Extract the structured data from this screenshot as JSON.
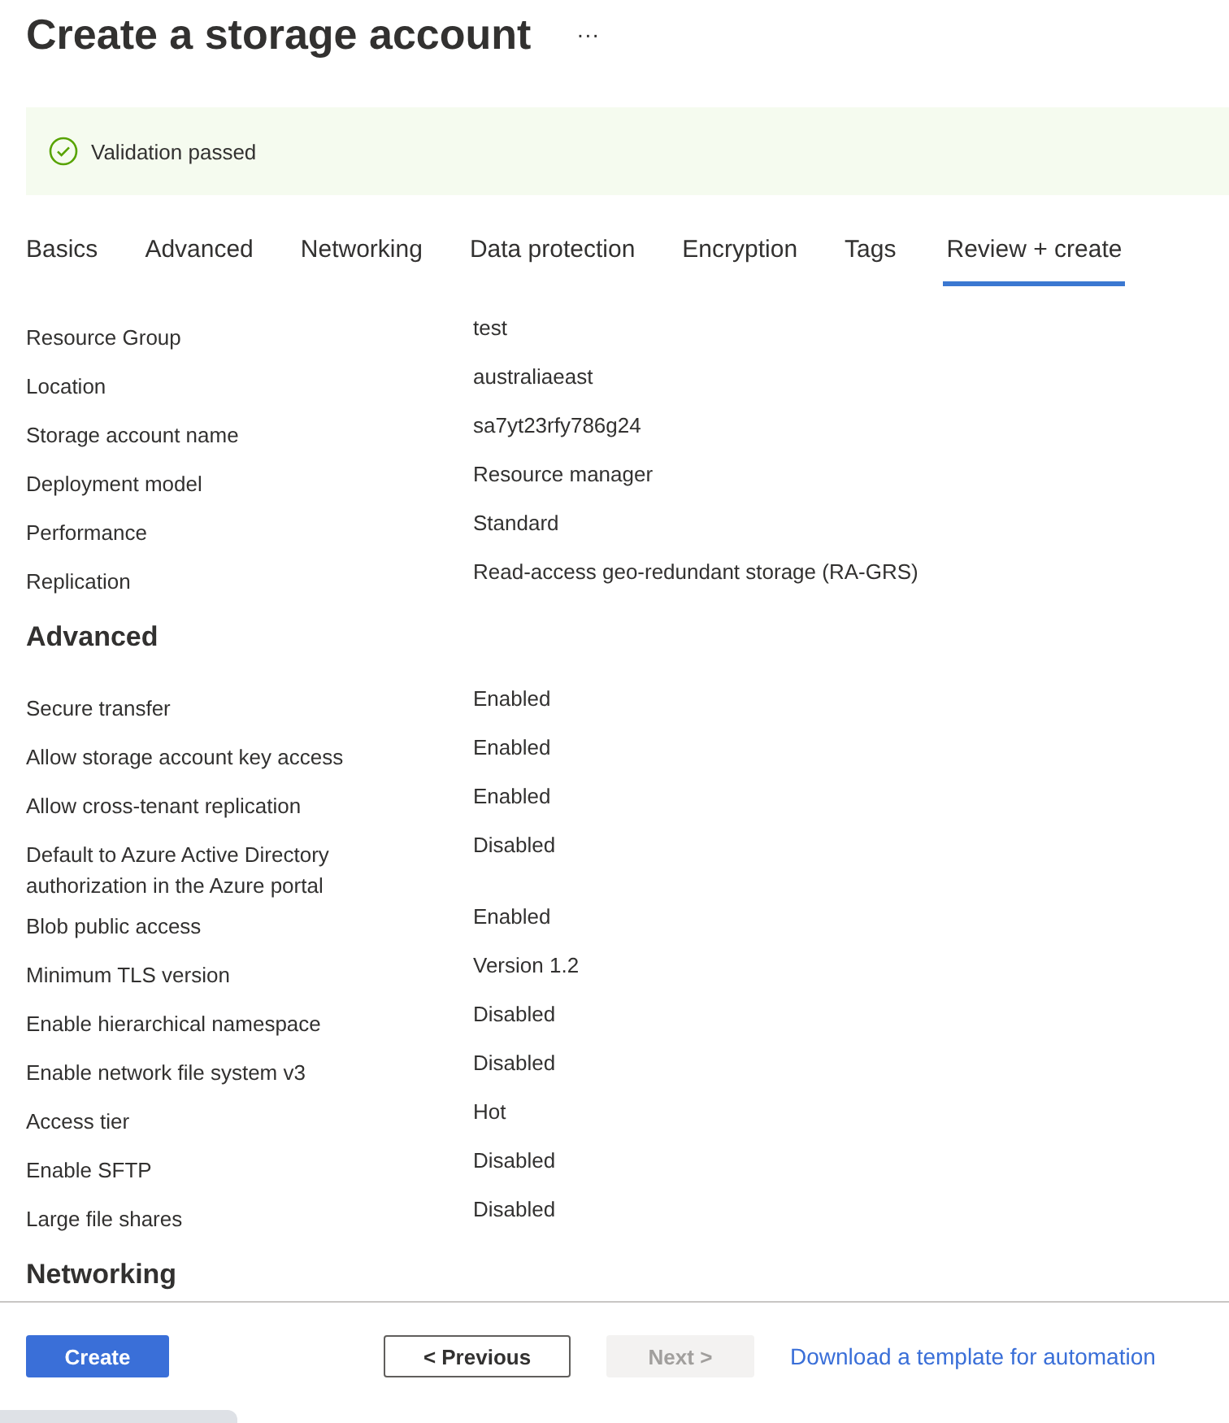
{
  "page": {
    "title": "Create a storage account",
    "more_menu": "···"
  },
  "banner": {
    "message": "Validation passed"
  },
  "tabs": [
    {
      "label": "Basics",
      "selected": false
    },
    {
      "label": "Advanced",
      "selected": false
    },
    {
      "label": "Networking",
      "selected": false
    },
    {
      "label": "Data protection",
      "selected": false
    },
    {
      "label": "Encryption",
      "selected": false
    },
    {
      "label": "Tags",
      "selected": false
    },
    {
      "label": "Review + create",
      "selected": true
    }
  ],
  "sections": [
    {
      "rows": [
        {
          "label": "Resource Group",
          "value": "test"
        },
        {
          "label": "Location",
          "value": "australiaeast"
        },
        {
          "label": "Storage account name",
          "value": "sa7yt23rfy786g24"
        },
        {
          "label": "Deployment model",
          "value": "Resource manager"
        },
        {
          "label": "Performance",
          "value": "Standard"
        },
        {
          "label": "Replication",
          "value": "Read-access geo-redundant storage (RA-GRS)"
        }
      ]
    },
    {
      "heading": "Advanced",
      "rows": [
        {
          "label": "Secure transfer",
          "value": "Enabled"
        },
        {
          "label": "Allow storage account key access",
          "value": "Enabled"
        },
        {
          "label": "Allow cross-tenant replication",
          "value": "Enabled"
        },
        {
          "label": "Default to Azure Active Directory authorization in the Azure portal",
          "value": "Disabled"
        },
        {
          "label": "Blob public access",
          "value": "Enabled"
        },
        {
          "label": "Minimum TLS version",
          "value": "Version 1.2"
        },
        {
          "label": "Enable hierarchical namespace",
          "value": "Disabled"
        },
        {
          "label": "Enable network file system v3",
          "value": "Disabled"
        },
        {
          "label": "Access tier",
          "value": "Hot"
        },
        {
          "label": "Enable SFTP",
          "value": "Disabled"
        },
        {
          "label": "Large file shares",
          "value": "Disabled"
        }
      ]
    },
    {
      "heading": "Networking"
    }
  ],
  "footer": {
    "buttons": [
      {
        "label": "Create",
        "kind": "primary",
        "disabled": false
      },
      {
        "label": "< Previous",
        "kind": "secondary",
        "disabled": false
      },
      {
        "label": "Next >",
        "kind": "secondary",
        "disabled": true
      }
    ],
    "link": "Download a template for automation"
  }
}
